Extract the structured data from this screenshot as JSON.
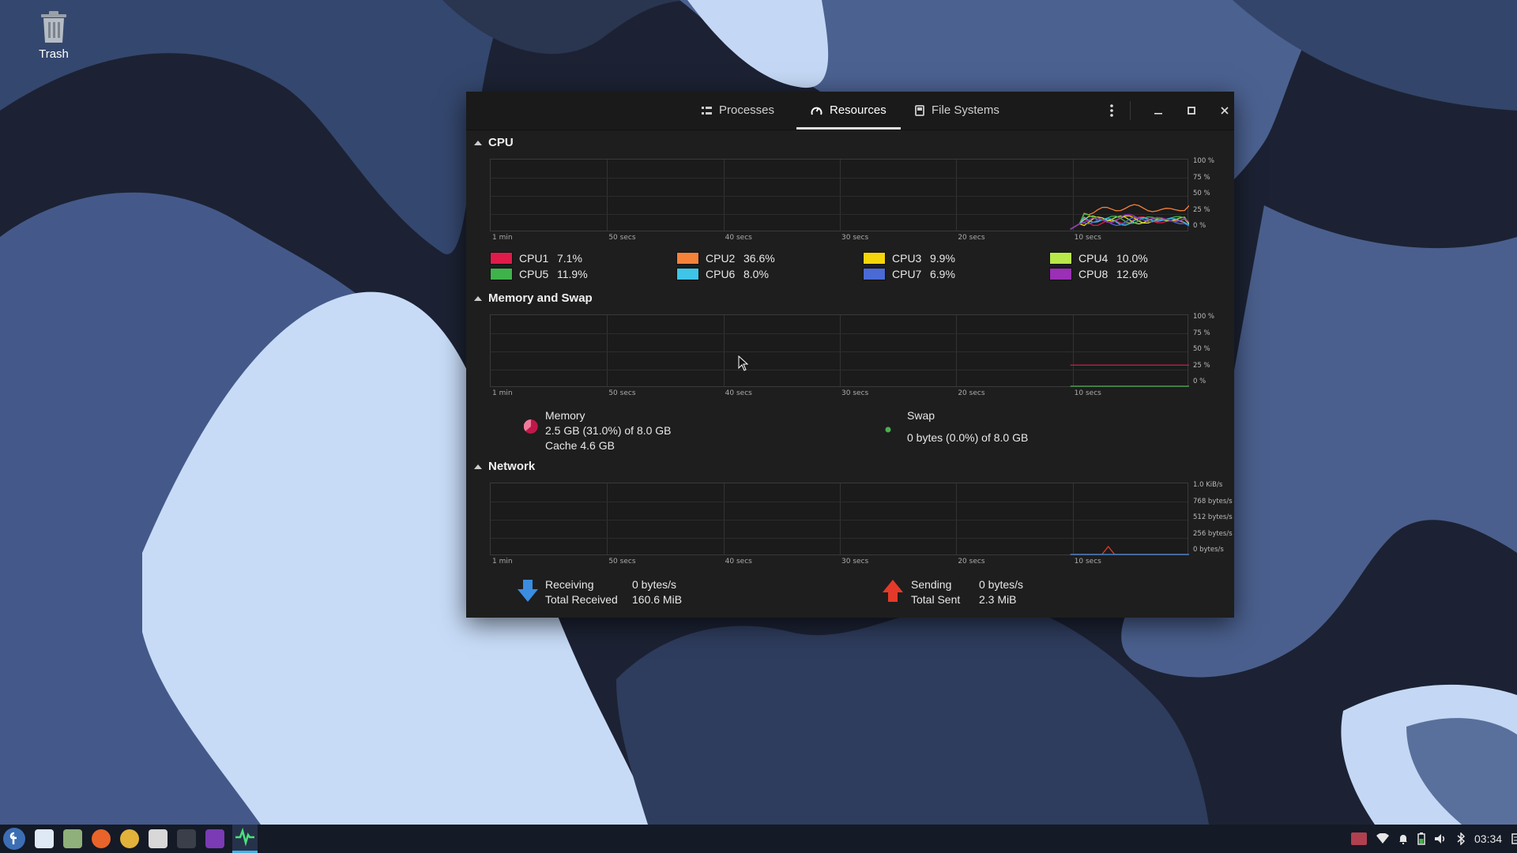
{
  "desktop": {
    "trash_label": "Trash"
  },
  "window": {
    "tabs": [
      {
        "label": "Processes",
        "icon": "list-icon",
        "active": false
      },
      {
        "label": "Resources",
        "icon": "gauge-icon",
        "active": true
      },
      {
        "label": "File Systems",
        "icon": "disk-icon",
        "active": false
      }
    ],
    "x_ticks": [
      "1 min",
      "50 secs",
      "40 secs",
      "30 secs",
      "20 secs",
      "10 secs"
    ],
    "cpu": {
      "title": "CPU",
      "y_ticks": [
        "100 %",
        "75 %",
        "50 %",
        "25 %",
        "0 %"
      ],
      "cores": [
        {
          "name": "CPU1",
          "value": "7.1%",
          "color": "#e01b4a"
        },
        {
          "name": "CPU2",
          "value": "36.6%",
          "color": "#f6823a"
        },
        {
          "name": "CPU3",
          "value": "9.9%",
          "color": "#f5d60a"
        },
        {
          "name": "CPU4",
          "value": "10.0%",
          "color": "#b9e84a"
        },
        {
          "name": "CPU5",
          "value": "11.9%",
          "color": "#3fb34b"
        },
        {
          "name": "CPU6",
          "value": "8.0%",
          "color": "#3ec5e8"
        },
        {
          "name": "CPU7",
          "value": "6.9%",
          "color": "#4a6ad6"
        },
        {
          "name": "CPU8",
          "value": "12.6%",
          "color": "#9b2fb5"
        }
      ]
    },
    "memory": {
      "title": "Memory and Swap",
      "y_ticks": [
        "100 %",
        "75 %",
        "50 %",
        "25 %",
        "0 %"
      ],
      "memory_label": "Memory",
      "memory_value": "2.5 GB (31.0%) of 8.0 GB",
      "cache_value": "Cache 4.6 GB",
      "memory_color": "#c1184a",
      "memory_percent": 31.0,
      "swap_label": "Swap",
      "swap_value": "0 bytes (0.0%) of 8.0 GB",
      "swap_color": "#4caf50",
      "swap_percent": 0.0
    },
    "network": {
      "title": "Network",
      "y_ticks": [
        "1.0 KiB/s",
        "768 bytes/s",
        "512 bytes/s",
        "256 bytes/s",
        "0 bytes/s"
      ],
      "receiving_label": "Receiving",
      "receiving_value": "0 bytes/s",
      "total_received_label": "Total Received",
      "total_received_value": "160.6 MiB",
      "sending_label": "Sending",
      "sending_value": "0 bytes/s",
      "total_sent_label": "Total Sent",
      "total_sent_value": "2.3 MiB",
      "receive_color": "#3a8de0",
      "send_color": "#e53a2a"
    }
  },
  "taskbar": {
    "clock": "03:34"
  }
}
